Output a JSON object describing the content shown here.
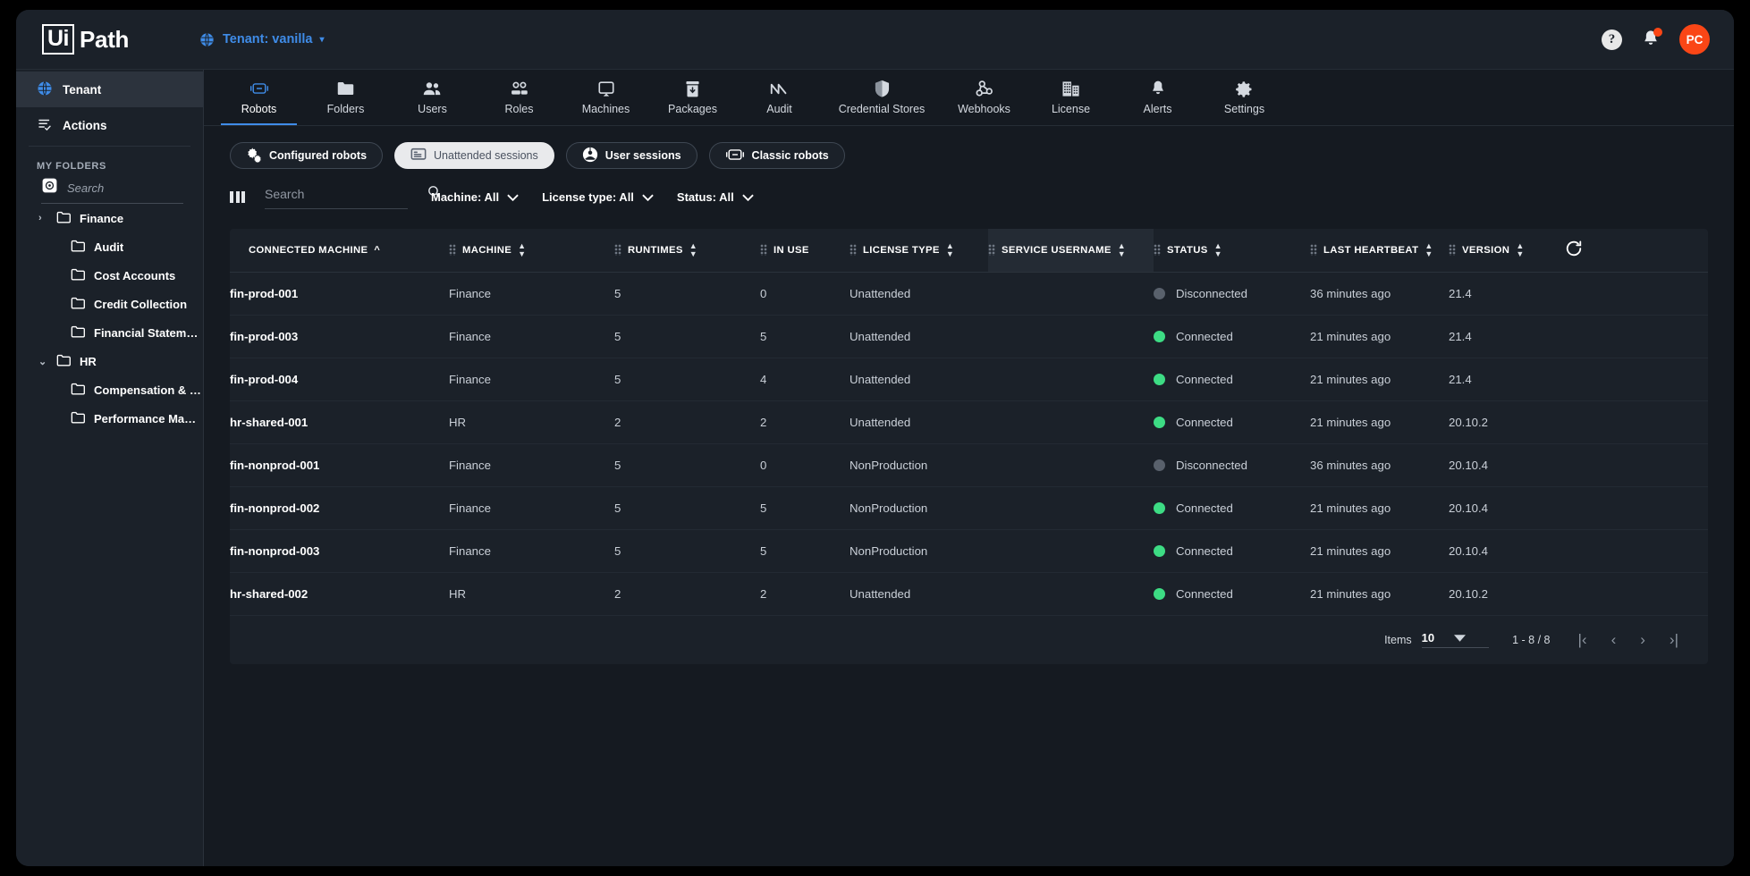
{
  "app": {
    "logo_ui": "Ui",
    "logo_path": "Path",
    "tenant_label": "Tenant: vanilla",
    "help_label": "?",
    "avatar_initials": "PC",
    "accent_blue": "#3f8ce8",
    "accent_orange": "#fa4616",
    "status_green": "#3ddc84",
    "status_grey": "#59616c"
  },
  "sidebar": {
    "items": [
      {
        "label": "Tenant",
        "icon": "globe-icon",
        "active": true
      },
      {
        "label": "Actions",
        "icon": "actions-list-icon",
        "active": false
      }
    ],
    "section_label": "MY FOLDERS",
    "search_placeholder": "Search",
    "search_value": "",
    "tree": [
      {
        "label": "Finance",
        "level": 0,
        "expanded": false,
        "chevron": "›"
      },
      {
        "label": "Audit",
        "level": 1
      },
      {
        "label": "Cost Accounts",
        "level": 1
      },
      {
        "label": "Credit Collection",
        "level": 1
      },
      {
        "label": "Financial Statements",
        "level": 1
      },
      {
        "label": "HR",
        "level": 0,
        "expanded": true,
        "chevron": "⌄"
      },
      {
        "label": "Compensation & Bene...",
        "level": 1
      },
      {
        "label": "Performance Manage...",
        "level": 1
      }
    ]
  },
  "tabs": [
    {
      "label": "Robots",
      "icon": "robot-icon",
      "active": true
    },
    {
      "label": "Folders",
      "icon": "folder-icon",
      "active": false
    },
    {
      "label": "Users",
      "icon": "users-icon",
      "active": false
    },
    {
      "label": "Roles",
      "icon": "roles-icon",
      "active": false
    },
    {
      "label": "Machines",
      "icon": "machine-monitor-icon",
      "active": false
    },
    {
      "label": "Packages",
      "icon": "package-icon",
      "active": false
    },
    {
      "label": "Audit",
      "icon": "audit-chart-icon",
      "active": false
    },
    {
      "label": "Credential Stores",
      "icon": "shield-icon",
      "active": false
    },
    {
      "label": "Webhooks",
      "icon": "webhook-icon",
      "active": false
    },
    {
      "label": "License",
      "icon": "building-icon",
      "active": false
    },
    {
      "label": "Alerts",
      "icon": "bell-icon",
      "active": false
    },
    {
      "label": "Settings",
      "icon": "gear-icon",
      "active": false
    }
  ],
  "subtabs": [
    {
      "label": "Configured robots",
      "icon": "gears-icon",
      "selected": false
    },
    {
      "label": "Unattended sessions",
      "icon": "monitor-icon",
      "selected": true
    },
    {
      "label": "User sessions",
      "icon": "user-circle-icon",
      "selected": false
    },
    {
      "label": "Classic robots",
      "icon": "robot-icon",
      "selected": false
    }
  ],
  "filters": {
    "columns_icon": "columns-icon",
    "search_placeholder": "Search",
    "search_value": "",
    "search_icon": "search-icon",
    "dropdowns": [
      {
        "label": "Machine: All"
      },
      {
        "label": "License type: All"
      },
      {
        "label": "Status: All"
      }
    ]
  },
  "table": {
    "columns": [
      {
        "label": "CONNECTED MACHINE",
        "sort": "asc",
        "grip": false,
        "highlight": false
      },
      {
        "label": "MACHINE",
        "sort": "both",
        "grip": true,
        "highlight": false
      },
      {
        "label": "RUNTIMES",
        "sort": "both",
        "grip": true,
        "highlight": false
      },
      {
        "label": "IN USE",
        "sort": "none",
        "grip": true,
        "highlight": false
      },
      {
        "label": "LICENSE TYPE",
        "sort": "both",
        "grip": true,
        "highlight": false
      },
      {
        "label": "SERVICE USERNAME",
        "sort": "both",
        "grip": true,
        "highlight": true
      },
      {
        "label": "STATUS",
        "sort": "both",
        "grip": true,
        "highlight": false
      },
      {
        "label": "LAST HEARTBEAT",
        "sort": "both",
        "grip": true,
        "highlight": false
      },
      {
        "label": "VERSION",
        "sort": "both",
        "grip": true,
        "highlight": false
      }
    ],
    "refresh_icon": "refresh-icon",
    "rows": [
      {
        "connected_machine": "fin-prod-001",
        "machine": "Finance",
        "runtimes": "5",
        "in_use": "0",
        "license_type": "Unattended",
        "service_username": "",
        "status": "Disconnected",
        "status_state": "disconnected",
        "last_heartbeat": "36 minutes ago",
        "version": "21.4"
      },
      {
        "connected_machine": "fin-prod-003",
        "machine": "Finance",
        "runtimes": "5",
        "in_use": "5",
        "license_type": "Unattended",
        "service_username": "",
        "status": "Connected",
        "status_state": "connected",
        "last_heartbeat": "21 minutes ago",
        "version": "21.4"
      },
      {
        "connected_machine": "fin-prod-004",
        "machine": "Finance",
        "runtimes": "5",
        "in_use": "4",
        "license_type": "Unattended",
        "service_username": "",
        "status": "Connected",
        "status_state": "connected",
        "last_heartbeat": "21 minutes ago",
        "version": "21.4"
      },
      {
        "connected_machine": "hr-shared-001",
        "machine": "HR",
        "runtimes": "2",
        "in_use": "2",
        "license_type": "Unattended",
        "service_username": "",
        "status": "Connected",
        "status_state": "connected",
        "last_heartbeat": "21 minutes ago",
        "version": "20.10.2"
      },
      {
        "connected_machine": "fin-nonprod-001",
        "machine": "Finance",
        "runtimes": "5",
        "in_use": "0",
        "license_type": "NonProduction",
        "service_username": "",
        "status": "Disconnected",
        "status_state": "disconnected",
        "last_heartbeat": "36 minutes ago",
        "version": "20.10.4"
      },
      {
        "connected_machine": "fin-nonprod-002",
        "machine": "Finance",
        "runtimes": "5",
        "in_use": "5",
        "license_type": "NonProduction",
        "service_username": "",
        "status": "Connected",
        "status_state": "connected",
        "last_heartbeat": "21 minutes ago",
        "version": "20.10.4"
      },
      {
        "connected_machine": "fin-nonprod-003",
        "machine": "Finance",
        "runtimes": "5",
        "in_use": "5",
        "license_type": "NonProduction",
        "service_username": "",
        "status": "Connected",
        "status_state": "connected",
        "last_heartbeat": "21 minutes ago",
        "version": "20.10.4"
      },
      {
        "connected_machine": "hr-shared-002",
        "machine": "HR",
        "runtimes": "2",
        "in_use": "2",
        "license_type": "Unattended",
        "service_username": "",
        "status": "Connected",
        "status_state": "connected",
        "last_heartbeat": "21 minutes ago",
        "version": "20.10.2"
      }
    ]
  },
  "pagination": {
    "items_label": "Items",
    "items_value": "10",
    "range": "1 - 8 / 8",
    "first_label": "|‹",
    "prev_label": "‹",
    "next_label": "›",
    "last_label": "›|"
  }
}
